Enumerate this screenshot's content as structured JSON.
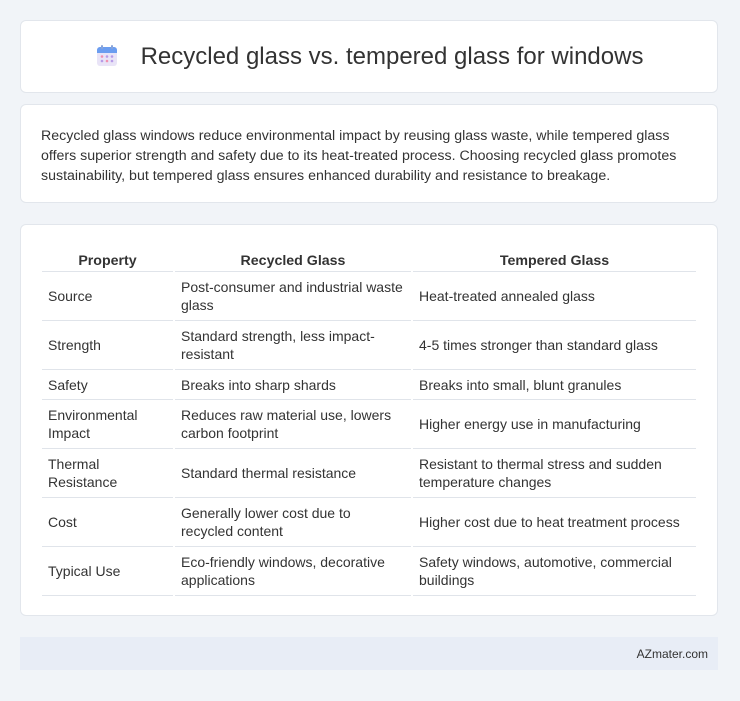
{
  "header": {
    "title": "Recycled glass vs. tempered glass for windows",
    "icon": "calendar-icon"
  },
  "intro": {
    "text": "Recycled glass windows reduce environmental impact by reusing glass waste, while tempered glass offers superior strength and safety due to its heat-treated process. Choosing recycled glass promotes sustainability, but tempered glass ensures enhanced durability and resistance to breakage."
  },
  "table": {
    "headers": [
      "Property",
      "Recycled Glass",
      "Tempered Glass"
    ],
    "rows": [
      {
        "property": "Source",
        "recycled": "Post-consumer and industrial waste glass",
        "tempered": "Heat-treated annealed glass"
      },
      {
        "property": "Strength",
        "recycled": "Standard strength, less impact-resistant",
        "tempered": "4-5 times stronger than standard glass"
      },
      {
        "property": "Safety",
        "recycled": "Breaks into sharp shards",
        "tempered": "Breaks into small, blunt granules"
      },
      {
        "property": "Environmental Impact",
        "recycled": "Reduces raw material use, lowers carbon footprint",
        "tempered": "Higher energy use in manufacturing"
      },
      {
        "property": "Thermal Resistance",
        "recycled": "Standard thermal resistance",
        "tempered": "Resistant to thermal stress and sudden temperature changes"
      },
      {
        "property": "Cost",
        "recycled": "Generally lower cost due to recycled content",
        "tempered": "Higher cost due to heat treatment process"
      },
      {
        "property": "Typical Use",
        "recycled": "Eco-friendly windows, decorative applications",
        "tempered": "Safety windows, automotive, commercial buildings"
      }
    ]
  },
  "footer": {
    "text": "AZmater.com"
  }
}
